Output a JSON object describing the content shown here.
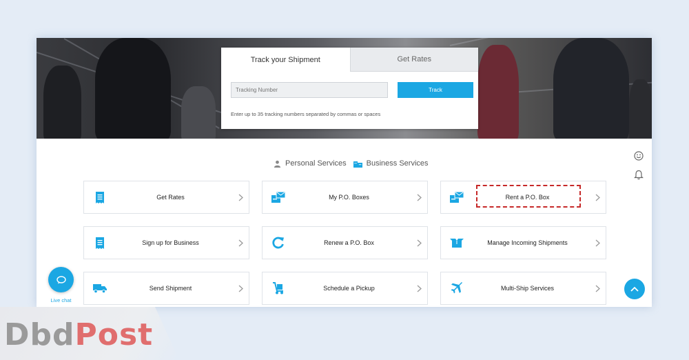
{
  "tracking": {
    "tabs": [
      {
        "label": "Track your Shipment",
        "active": true
      },
      {
        "label": "Get Rates",
        "active": false
      }
    ],
    "input_placeholder": "Tracking Number",
    "track_button": "Track",
    "hint": "Enter up to 35 tracking numbers separated by commas or spaces"
  },
  "service_toggle": {
    "personal": "Personal Services",
    "business": "Business Services"
  },
  "services": [
    {
      "label": "Get Rates",
      "icon": "receipt-icon"
    },
    {
      "label": "My P.O. Boxes",
      "icon": "po-box-icon"
    },
    {
      "label": "Rent a P.O. Box",
      "icon": "po-box-icon"
    },
    {
      "label": "Sign up for Business",
      "icon": "receipt-icon"
    },
    {
      "label": "Renew a P.O. Box",
      "icon": "refresh-icon"
    },
    {
      "label": "Manage Incoming Shipments",
      "icon": "open-box-icon"
    },
    {
      "label": "Send Shipment",
      "icon": "delivery-truck-icon"
    },
    {
      "label": "Schedule a Pickup",
      "icon": "hand-truck-icon"
    },
    {
      "label": "Multi-Ship Services",
      "icon": "airplane-icon"
    }
  ],
  "highlighted_service": "Rent a P.O. Box",
  "live_chat": {
    "label": "Live chat"
  },
  "watermark": {
    "part1": "Dbd",
    "part2": "Post"
  },
  "colors": {
    "accent": "#1ba7e3",
    "highlight": "#c62828"
  }
}
